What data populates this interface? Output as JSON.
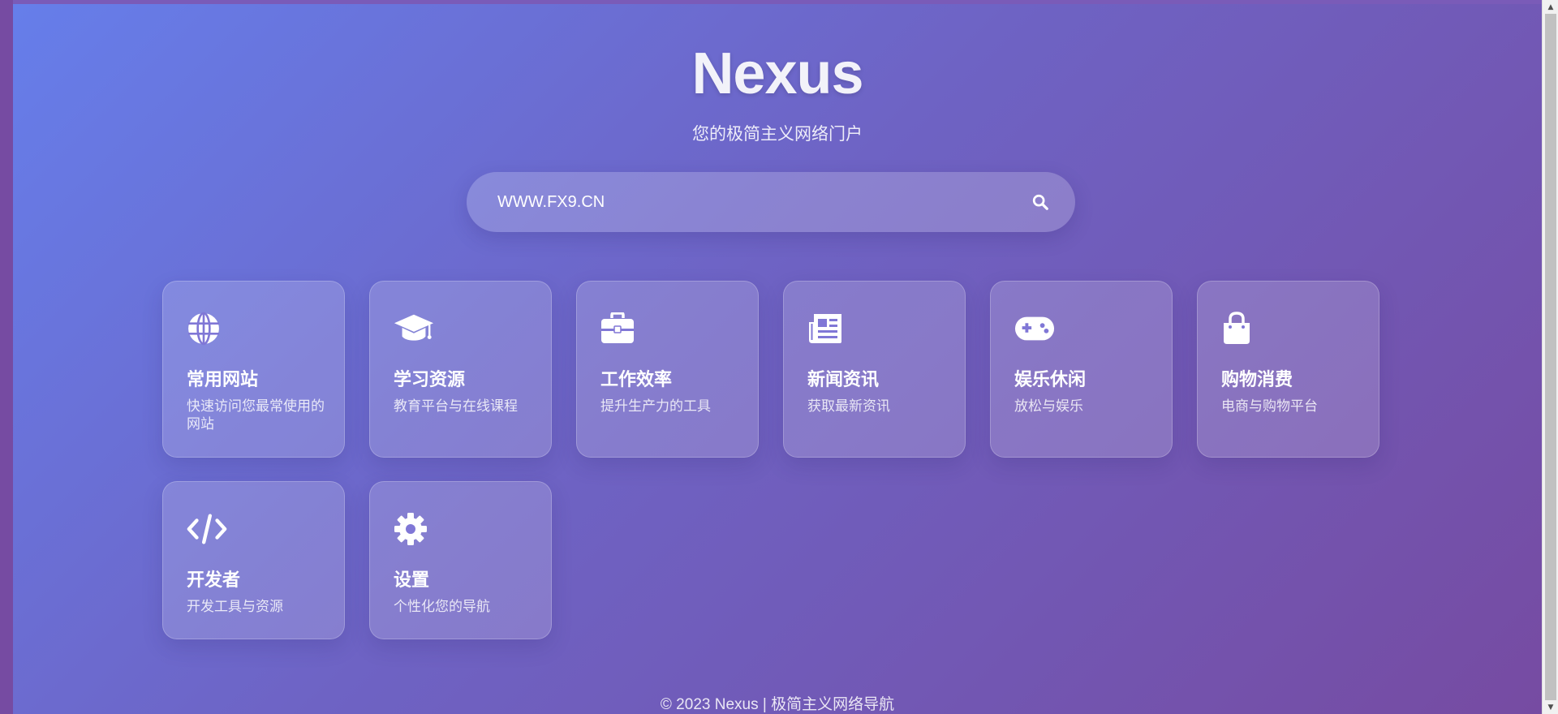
{
  "header": {
    "title": "Nexus",
    "subtitle": "您的极简主义网络门户"
  },
  "search": {
    "value": "WWW.FX9.CN",
    "icon": "search-icon"
  },
  "cards": [
    {
      "title": "常用网站",
      "desc": "快速访问您最常使用的网站",
      "icon": "globe-icon"
    },
    {
      "title": "学习资源",
      "desc": "教育平台与在线课程",
      "icon": "graduation-cap-icon"
    },
    {
      "title": "工作效率",
      "desc": "提升生产力的工具",
      "icon": "briefcase-icon"
    },
    {
      "title": "新闻资讯",
      "desc": "获取最新资讯",
      "icon": "newspaper-icon"
    },
    {
      "title": "娱乐休闲",
      "desc": "放松与娱乐",
      "icon": "gamepad-icon"
    },
    {
      "title": "购物消费",
      "desc": "电商与购物平台",
      "icon": "shopping-bag-icon"
    },
    {
      "title": "开发者",
      "desc": "开发工具与资源",
      "icon": "code-icon"
    },
    {
      "title": "设置",
      "desc": "个性化您的导航",
      "icon": "gear-icon"
    }
  ],
  "footer": {
    "text": "© 2023 Nexus | 极简主义网络导航"
  },
  "colors": {
    "gradient_start": "#667eea",
    "gradient_end": "#764ba2"
  }
}
